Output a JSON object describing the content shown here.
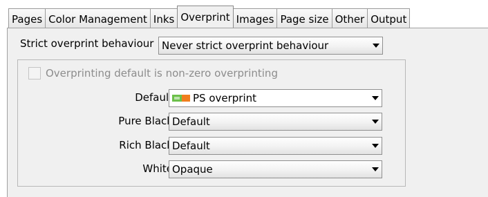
{
  "tabs": [
    {
      "label": "Pages"
    },
    {
      "label": "Color Management"
    },
    {
      "label": "Inks"
    },
    {
      "label": "Overprint",
      "active": true
    },
    {
      "label": "Images"
    },
    {
      "label": "Page size"
    },
    {
      "label": "Other"
    },
    {
      "label": "Output"
    }
  ],
  "overprint": {
    "strict_label": "Strict overprint behaviour",
    "strict_value": "Never strict overprint behaviour",
    "nonzero_checkbox": {
      "label": "Overprinting default is non-zero overprinting",
      "checked": false,
      "enabled": false
    },
    "default_label": "Default",
    "default_value": "PS overprint",
    "default_icon": "ps-overprint-swatch-icon",
    "pure_black_label": "Pure Black",
    "pure_black_value": "Default",
    "rich_black_label": "Rich Black",
    "rich_black_value": "Default",
    "white_label": "White",
    "white_value": "Opaque"
  },
  "colors": {
    "page_background": "#f0f0f0",
    "disabled_text": "#8c8c8c",
    "swatch_green": "#6cc04a",
    "swatch_orange": "#f07e1e"
  }
}
